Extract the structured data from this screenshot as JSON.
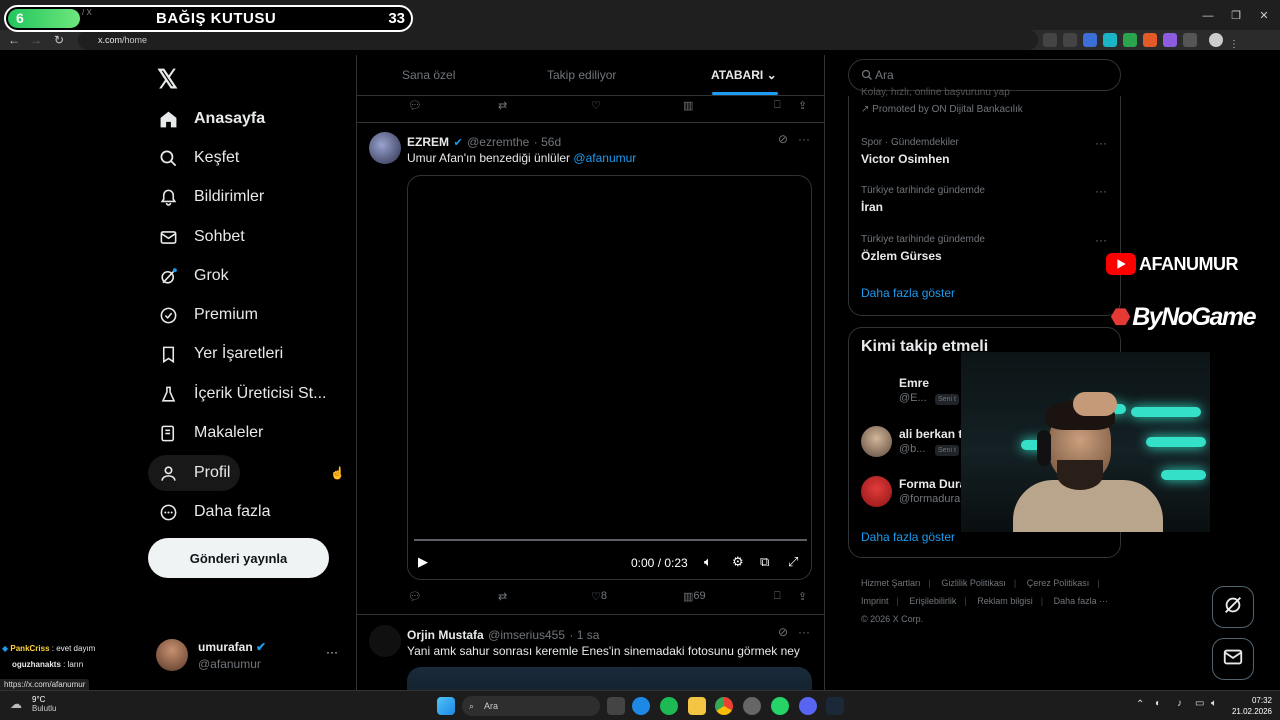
{
  "donation": {
    "count": "6",
    "title": "BAĞIŞ KUTUSU",
    "goal": "33",
    "sep": "/ X"
  },
  "browser": {
    "url_host": "x.com",
    "url_path": "/home",
    "status_url": "https://x.com/afanumur"
  },
  "nav": {
    "items": [
      {
        "label": "Anasayfa",
        "icon": "home-icon"
      },
      {
        "label": "Keşfet",
        "icon": "search-icon"
      },
      {
        "label": "Bildirimler",
        "icon": "bell-icon"
      },
      {
        "label": "Sohbet",
        "icon": "mail-icon"
      },
      {
        "label": "Grok",
        "icon": "grok-icon"
      },
      {
        "label": "Premium",
        "icon": "verified-icon"
      },
      {
        "label": "Yer İşaretleri",
        "icon": "bookmark-icon"
      },
      {
        "label": "İçerik Üreticisi St...",
        "icon": "creator-icon"
      },
      {
        "label": "Makaleler",
        "icon": "article-icon"
      },
      {
        "label": "Profil",
        "icon": "person-icon"
      },
      {
        "label": "Daha fazla",
        "icon": "more-circle-icon"
      }
    ],
    "post_button": "Gönderi yayınla"
  },
  "account": {
    "name": "umurafan",
    "handle": "@afanumur",
    "more": "···"
  },
  "tabs": {
    "for_you": "Sana özel",
    "following": "Takip ediliyor",
    "list": "ATABARI"
  },
  "tweets": [
    {
      "name": "EZREM",
      "handle": "@ezremthe",
      "time": "· 56d",
      "text": "Umur Afan'ın benzediği ünlüler",
      "mention": "@afanumur",
      "video_time": "0:00 / 0:23",
      "likes": "8",
      "views": "69"
    },
    {
      "name": "Orjin Mustafa",
      "handle": "@imserius455",
      "time": "· 1 sa",
      "text": "Yani amk sahur sonrası keremle Enes'in sinemadaki fotosunu görmek ney"
    }
  ],
  "search": {
    "placeholder": "Ara"
  },
  "trends": {
    "top_text": "Kolay, hızlı, online başvurunu yap",
    "promoted": "Promoted by ON Dijital Bankacılık",
    "items": [
      {
        "meta": "Spor · Gündemdekiler",
        "name": "Victor Osimhen"
      },
      {
        "meta": "Türkiye tarihinde gündemde",
        "name": "İran"
      },
      {
        "meta": "Türkiye tarihinde gündemde",
        "name": "Özlem Gürses"
      }
    ],
    "show_more": "Daha fazla göster"
  },
  "who_to_follow": {
    "title": "Kimi takip etmeli",
    "items": [
      {
        "name": "Emre",
        "handle": "@E...",
        "badge": "Seni t"
      },
      {
        "name": "ali berkan t",
        "handle": "@b...",
        "badge": "Seni t"
      },
      {
        "name": "Forma Dura",
        "handle": "@formadura"
      }
    ],
    "show_more": "Daha fazla göster"
  },
  "footer": {
    "links": [
      "Hizmet Şartları",
      "Gizlilik Politikası",
      "Çerez Politikası",
      "Imprint",
      "Erişilebilirlik",
      "Reklam bilgisi",
      "Daha fazla ···"
    ],
    "copyright": "© 2026 X Corp."
  },
  "branding": {
    "youtube": "AFANUMUR",
    "bynogame": "ByNoGame"
  },
  "chat": [
    {
      "user": "PankCriss",
      "msg": ": evet dayım"
    },
    {
      "user": "oguzhanakts",
      "msg": ": ların"
    }
  ],
  "taskbar": {
    "temp": "9°C",
    "weather": "Bulutlu",
    "search": "Ara",
    "time": "07:32",
    "date": "21.02.2026"
  },
  "colors": {
    "accent": "#1d9bf0",
    "background": "#000000",
    "border": "#2f3336",
    "muted": "#71767b"
  }
}
